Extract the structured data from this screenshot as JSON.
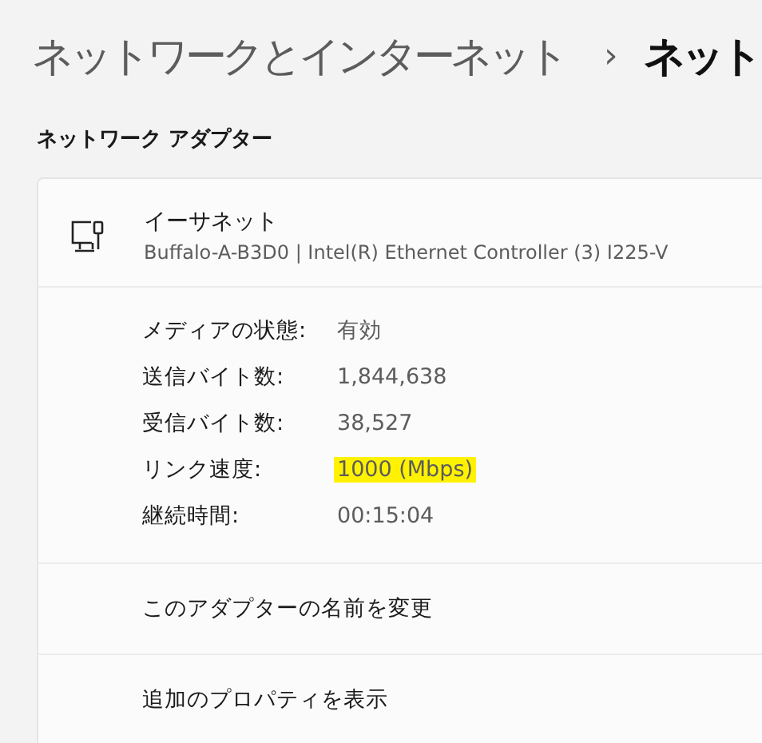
{
  "breadcrumb": {
    "parent": "ネットワークとインターネット",
    "separator": "›",
    "current": "ネット"
  },
  "section_title": "ネットワーク アダプター",
  "adapter": {
    "name": "イーサネット",
    "description": "Buffalo-A-B3D0 | Intel(R) Ethernet Controller (3) I225-V"
  },
  "properties": [
    {
      "label": "メディアの状態:",
      "value": "有効",
      "highlighted": false
    },
    {
      "label": "送信バイト数:",
      "value": "1,844,638",
      "highlighted": false
    },
    {
      "label": "受信バイト数:",
      "value": "38,527",
      "highlighted": false
    },
    {
      "label": "リンク速度:",
      "value": "1000 (Mbps)",
      "highlighted": true
    },
    {
      "label": "継続時間:",
      "value": "00:15:04",
      "highlighted": false
    }
  ],
  "actions": [
    "このアダプターの名前を変更",
    "追加のプロパティを表示"
  ]
}
